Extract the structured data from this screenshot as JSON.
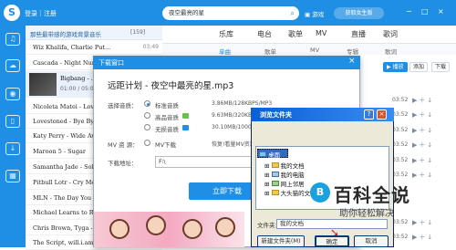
{
  "topbar": {
    "logo": "S",
    "login": "登录｜注册",
    "search_value": "夜空最亮的星",
    "games": "游戏",
    "user_label": "获取女生版",
    "win_min": "−",
    "win_max": "□",
    "win_close": "×"
  },
  "playlist": {
    "title": "那些最带感的游戏背景音乐",
    "count": "[159]",
    "rows": [
      {
        "title": "Wiz Khalifa, Charlie Put...",
        "time": "03:49"
      },
      {
        "title": "Cascada - Night Nurse",
        "time": ""
      },
      {
        "title": "Nicoleta Matei - Love",
        "time": ""
      },
      {
        "title": "Lovestoned - Bye Bye",
        "time": ""
      },
      {
        "title": "Katy Perry - Wide Awa",
        "time": ""
      },
      {
        "title": "Maroon 5 - Sugar",
        "time": ""
      },
      {
        "title": "Samantha Jade - Soldi",
        "time": ""
      },
      {
        "title": "Pitbull Lotr - Cry Me",
        "time": ""
      },
      {
        "title": "MLN - The Day You Wen",
        "time": ""
      },
      {
        "title": "Michael Learns to Roc",
        "time": ""
      },
      {
        "title": "Chris Brown, Tyga - A",
        "time": ""
      },
      {
        "title": "The Script, will.i.am",
        "time": ""
      }
    ],
    "now_playing_title": "Bigbang - ...",
    "now_playing_time": "01:00 / 05:03"
  },
  "tabs": {
    "main": [
      "乐库",
      "电台",
      "歌单",
      "MV",
      "直播",
      "歌词"
    ],
    "sub": [
      "单曲",
      "歌单",
      "MV",
      "专辑",
      "歌词"
    ]
  },
  "list_toolbar": {
    "play": "▶ 播放",
    "add": "添加",
    "download": "下载"
  },
  "right_rows": [
    {
      "time": "03:52"
    },
    {
      "time": "03:52"
    },
    {
      "time": "03:52"
    },
    {
      "time": "03:52"
    },
    {
      "time": "03:52"
    },
    {
      "time": "03:52"
    },
    {
      "time": "03:52"
    },
    {
      "time": "03:52"
    }
  ],
  "download_dialog": {
    "title": "下载窗口",
    "close": "×",
    "file_name": "远距计划 - 夜空中最亮的星.mp3",
    "quality_label": "选择音质：",
    "qualities": [
      {
        "name": "标准音质",
        "size": "3.86MB/128KBPS/MP3",
        "color": "#ffffff"
      },
      {
        "name": "高品音质",
        "size": "9.63MB/320KBPS/MP3",
        "color": "#6cc04a"
      },
      {
        "name": "无损音质",
        "size": "30.10MB/1000+KBPS/FLAC",
        "color": "#1f8fe5"
      }
    ],
    "mv_label": "MV 资 源：",
    "mv_option": "MV下载",
    "mv_hint": "恢复!看量MV资源",
    "path_label": "下载地址：",
    "path_value": "F:\\",
    "download_button": "立即下载"
  },
  "browse_dialog": {
    "title": "浏览文件夹",
    "help": "?",
    "close": "×",
    "tree": [
      {
        "label": "桌面",
        "level": 0
      },
      {
        "label": "我的文档",
        "level": 1
      },
      {
        "label": "我的电脑",
        "level": 1
      },
      {
        "label": "网上邻居",
        "level": 1
      },
      {
        "label": "大头猫的文件",
        "level": 1
      }
    ],
    "folder_label": "文件夹：",
    "folder_value": "我的文档",
    "new_folder": "新建文件夹(M)",
    "ok": "确定",
    "cancel": "取消"
  },
  "watermark": {
    "title": "百科全说",
    "subtitle": "助你轻松解决",
    "logo": "B"
  },
  "colors": {
    "brand": "#1f8fe5",
    "xp_title": "#0a5fd8"
  }
}
